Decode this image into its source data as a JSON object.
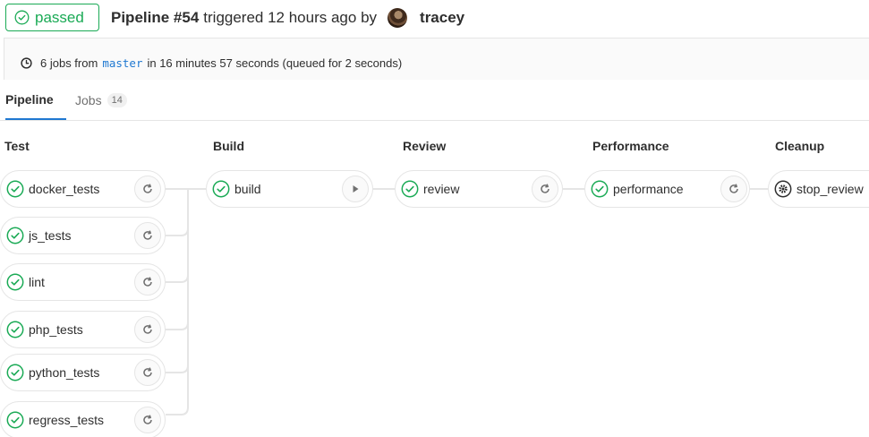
{
  "header": {
    "status_label": "passed",
    "pipeline_label": "Pipeline #54",
    "triggered_text": "triggered 12 hours ago by",
    "author": "tracey"
  },
  "info": {
    "jobs_count_text": "6 jobs from",
    "ref": "master",
    "duration_text": "in 16 minutes 57 seconds (queued for 2 seconds)"
  },
  "tabs": [
    {
      "label": "Pipeline",
      "active": true
    },
    {
      "label": "Jobs",
      "count": "14",
      "active": false
    }
  ],
  "stages": [
    {
      "name": "Test",
      "jobs": [
        {
          "name": "docker_tests",
          "status": "success",
          "action": "retry"
        },
        {
          "name": "js_tests",
          "status": "success",
          "action": "retry"
        },
        {
          "name": "lint",
          "status": "success",
          "action": "retry"
        },
        {
          "name": "php_tests",
          "status": "success",
          "action": "retry"
        },
        {
          "name": "python_tests",
          "status": "success",
          "action": "retry"
        },
        {
          "name": "regress_tests",
          "status": "success",
          "action": "retry"
        }
      ]
    },
    {
      "name": "Build",
      "jobs": [
        {
          "name": "build",
          "status": "success",
          "action": "play"
        }
      ]
    },
    {
      "name": "Review",
      "jobs": [
        {
          "name": "review",
          "status": "success",
          "action": "retry"
        }
      ]
    },
    {
      "name": "Performance",
      "jobs": [
        {
          "name": "performance",
          "status": "success",
          "action": "retry"
        }
      ]
    },
    {
      "name": "Cleanup",
      "jobs": [
        {
          "name": "stop_review",
          "status": "manual",
          "action": "none"
        }
      ]
    }
  ],
  "icons": {
    "status_success": "check-circle-icon",
    "status_manual": "gear-circle-icon",
    "retry": "retry-icon",
    "play": "play-icon",
    "clock": "clock-icon"
  },
  "colors": {
    "success": "#1aaa55",
    "link": "#1f78d1",
    "tab_active_border": "#1f78d1",
    "border": "#e5e5e5"
  }
}
